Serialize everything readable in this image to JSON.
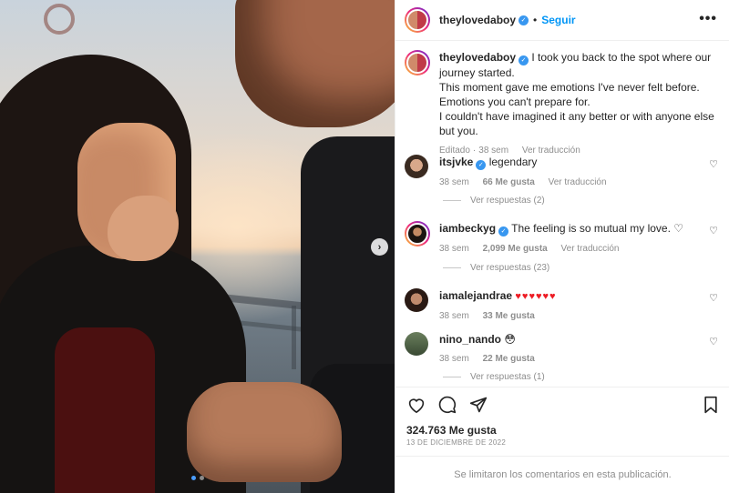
{
  "header": {
    "username": "theylovedaboy",
    "separator": "•",
    "follow_label": "Seguir",
    "more_label": "•••"
  },
  "caption": {
    "username": "theylovedaboy",
    "lines": [
      "I took you back to the spot where our journey started.",
      "This moment gave me emotions I've never felt before. Emotions you can't prepare for.",
      "I couldn't have imagined it any better or with anyone else but you."
    ],
    "edited": "Editado",
    "sep": "·",
    "time": "38 sem",
    "translate": "Ver traducción"
  },
  "comments": [
    {
      "username": "itsjvke",
      "verified": true,
      "text": "legendary",
      "time": "38 sem",
      "likes": "66 Me gusta",
      "translate": "Ver traducción",
      "replies": "Ver respuestas (2)"
    },
    {
      "username": "iambeckyg",
      "verified": true,
      "text": "The feeling is so mutual my love. ♡",
      "time": "38 sem",
      "likes": "2,099 Me gusta",
      "translate": "Ver traducción",
      "replies": "Ver respuestas (23)"
    },
    {
      "username": "iamalejandrae",
      "verified": false,
      "text": "♥♥♥♥♥♥",
      "time": "38 sem",
      "likes": "33 Me gusta"
    },
    {
      "username": "nino_nando",
      "verified": false,
      "text": "😳",
      "time": "38 sem",
      "likes": "22 Me gusta",
      "replies": "Ver respuestas (1)"
    }
  ],
  "stats": {
    "likes": "324.763 Me gusta",
    "date": "13 DE DICIEMBRE DE 2022"
  },
  "footer": {
    "limited_text": "Se limitaron los comentarios en esta publicación."
  },
  "colors": {
    "accent": "#0095f6",
    "verified": "#3897f0",
    "muted": "#8e8e8e",
    "heart_red": "#ed1c24"
  },
  "carousel": {
    "slides": 2,
    "active": 1
  },
  "icons": [
    "like-icon",
    "comment-icon",
    "share-icon",
    "bookmark-icon",
    "next-icon"
  ]
}
